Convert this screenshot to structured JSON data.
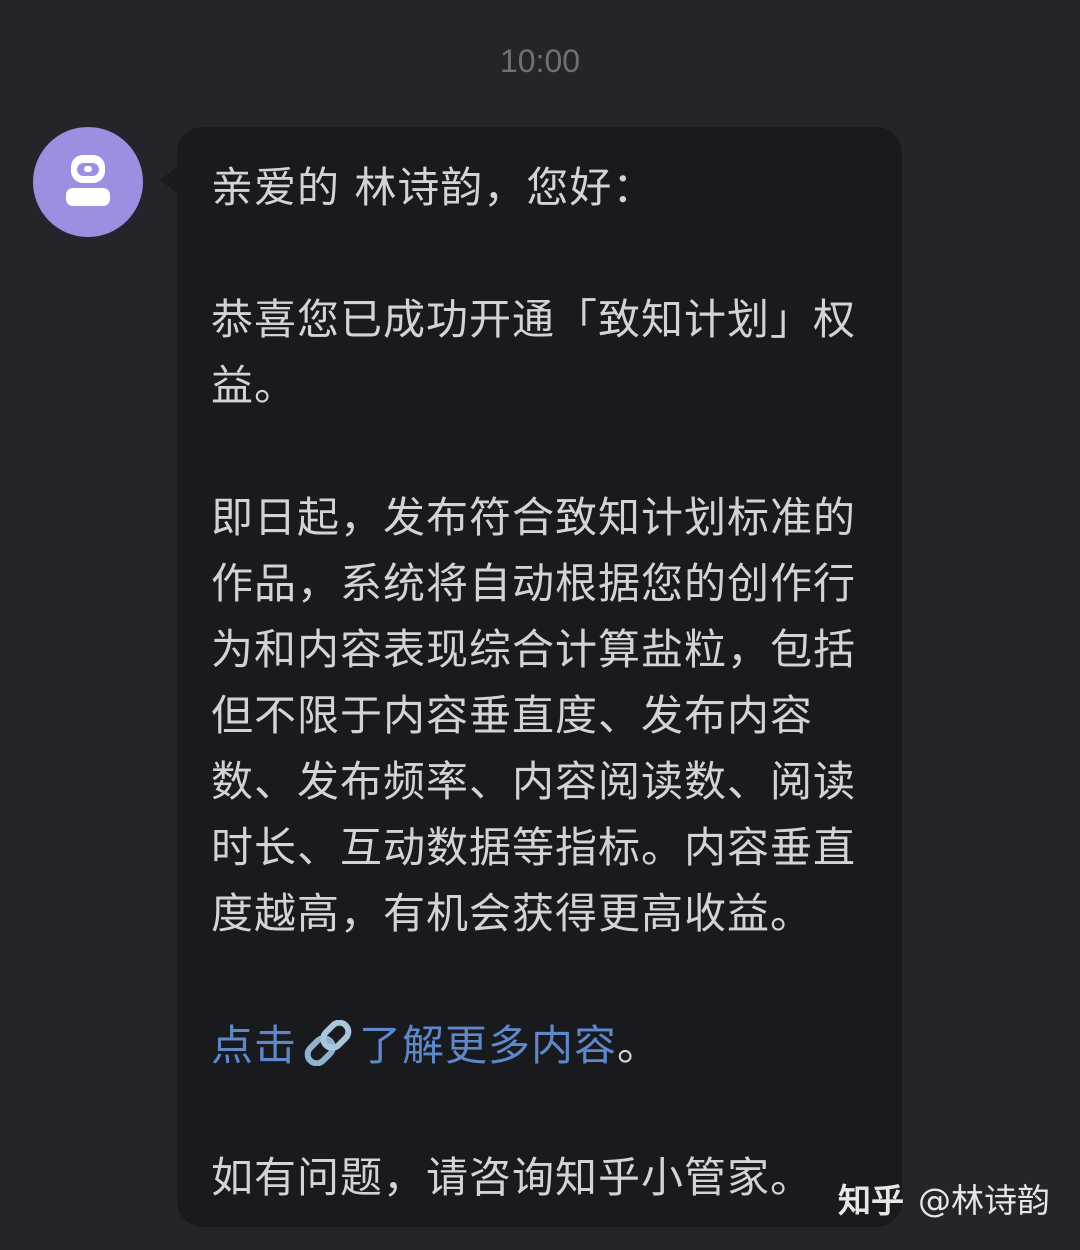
{
  "chat": {
    "timestamp": "10:00",
    "sender_avatar_icon": "user-icon",
    "message": {
      "greeting": "亲爱的 林诗韵，您好：",
      "paragraph_1": "恭喜您已成功开通「致知计划」权益。",
      "paragraph_2": "即日起，发布符合致知计划标准的作品，系统将自动根据您的创作行为和内容表现综合计算盐粒，包括但不限于内容垂直度、发布内容数、发布频率、内容阅读数、阅读时长、互动数据等指标。内容垂直度越高，有机会获得更高收益。",
      "link_prefix": "点击",
      "link_icon": "link-icon",
      "link_text": "了解更多内容",
      "link_suffix": "。",
      "closing": "如有问题，请咨询知乎小管家。"
    }
  },
  "watermark": {
    "brand": "知乎",
    "author": "@林诗韵"
  },
  "colors": {
    "background": "#23252a",
    "bubble": "#191a1e",
    "text": "#d2d3d6",
    "link": "#5f87c9",
    "avatar": "#9d8ee2",
    "timestamp": "#6e7076"
  }
}
